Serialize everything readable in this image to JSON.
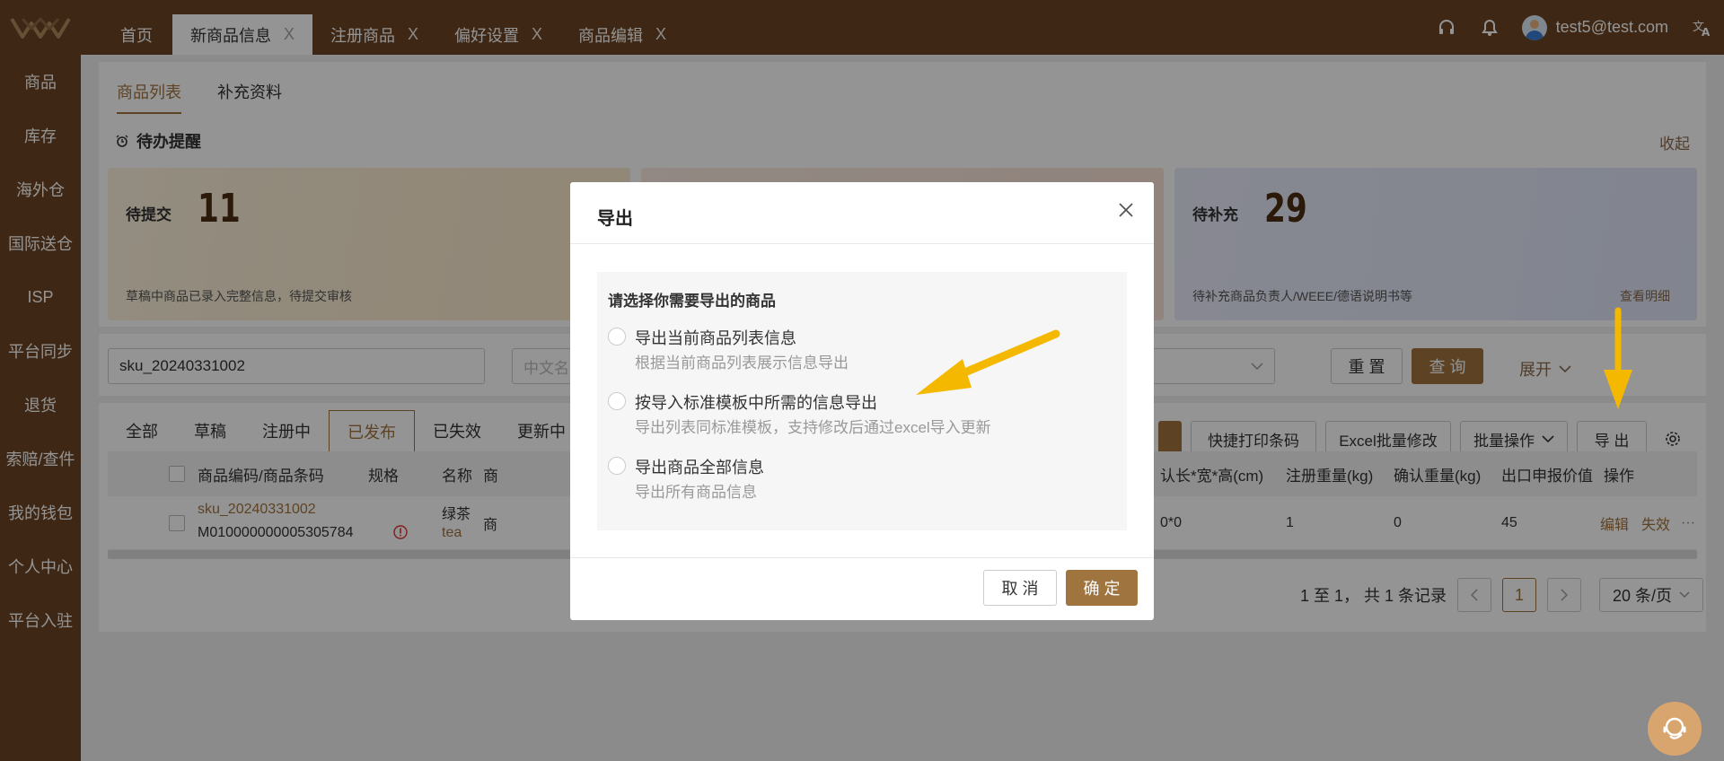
{
  "topbar": {
    "tabs": [
      {
        "label": "首页"
      },
      {
        "label": "新商品信息"
      },
      {
        "label": "注册商品"
      },
      {
        "label": "偏好设置"
      },
      {
        "label": "商品编辑"
      }
    ],
    "tab_close": "X",
    "user_email": "test5@test.com",
    "icons": [
      "headset-icon",
      "bell-icon",
      "translate-icon"
    ]
  },
  "sidebar": {
    "items": [
      {
        "label": "商品"
      },
      {
        "label": "库存"
      },
      {
        "label": "海外仓"
      },
      {
        "label": "国际送仓"
      },
      {
        "label": "ISP"
      },
      {
        "label": "平台同步"
      },
      {
        "label": "退货"
      },
      {
        "label": "索赔/查件"
      },
      {
        "label": "我的钱包"
      },
      {
        "label": "个人中心"
      },
      {
        "label": "平台入驻"
      }
    ]
  },
  "subtabs": [
    "商品列表",
    "补充资料"
  ],
  "todo": {
    "title": "待办提醒",
    "collapse": "收起",
    "cards": [
      {
        "title": "待提交",
        "count": "11",
        "desc": "草稿中商品已录入完整信息，待提交审核"
      },
      {
        "title": "待补充",
        "count": "29",
        "desc": "待补充商品负责人/WEEE/德语说明书等",
        "link": "查看明细"
      }
    ]
  },
  "filters": {
    "sku_value": "sku_20240331002",
    "cn_name_placeholder": "中文名",
    "reset": "重 置",
    "query": "查 询",
    "expand": "展开"
  },
  "status_tabs": [
    "全部",
    "草稿",
    "注册中",
    "已发布",
    "已失效",
    "更新中"
  ],
  "actions": {
    "print_barcode": "快捷打印条码",
    "excel_edit": "Excel批量修改",
    "batch": "批量操作",
    "export": "导 出"
  },
  "table": {
    "headers": {
      "code": "商品编码/商品条码",
      "spec": "规格",
      "name": "名称",
      "name2": "商",
      "dims": "认长*宽*高(cm)",
      "reg_weight": "注册重量(kg)",
      "confirm_weight": "确认重量(kg)",
      "declare": "出口申报价值",
      "ops": "操作"
    },
    "row": {
      "sku": "sku_20240331002",
      "barcode": "M010000000005305784",
      "name": "绿茶",
      "name_en": "tea",
      "name2": "商",
      "dims": "0*0",
      "reg_weight": "1",
      "confirm_weight": "0",
      "declare": "45",
      "edit": "编辑",
      "invalidate": "失效",
      "more": "···"
    }
  },
  "pager": {
    "summary": "1 至 1， 共 1 条记录",
    "current": "1",
    "page_size": "20 条/页"
  },
  "modal": {
    "title": "导出",
    "question": "请选择你需要导出的商品",
    "options": [
      {
        "label": "导出当前商品列表信息",
        "sub": "根据当前商品列表展示信息导出"
      },
      {
        "label": "按导入标准模板中所需的信息导出",
        "sub": "导出列表同标准模板，支持修改后通过excel导入更新"
      },
      {
        "label": "导出商品全部信息",
        "sub": "导出所有商品信息"
      }
    ],
    "cancel": "取 消",
    "confirm": "确 定"
  },
  "colors": {
    "brand": "#6b4423",
    "accent": "#a0743f",
    "annotation_arrow": "#f5b800"
  }
}
